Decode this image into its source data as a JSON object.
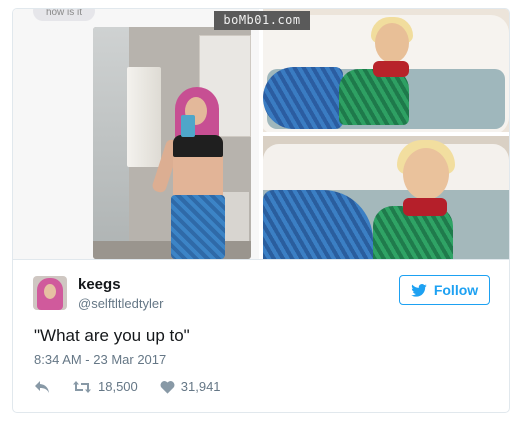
{
  "watermark": "boMb01.com",
  "media": {
    "chat_bubble_text": "how is it"
  },
  "tweet": {
    "display_name": "keegs",
    "handle": "@selftltledtyler",
    "follow_label": "Follow",
    "text": "\"What are you up to\"",
    "timestamp": "8:34 AM - 23 Mar 2017",
    "retweets": "18,500",
    "likes": "31,941"
  },
  "colors": {
    "accent": "#1da1f2",
    "secondary_text": "#657786",
    "primary_text": "#14171a"
  },
  "icons": {
    "reply": "reply-icon",
    "retweet": "retweet-icon",
    "like": "heart-icon",
    "follow": "twitter-bird-icon"
  }
}
